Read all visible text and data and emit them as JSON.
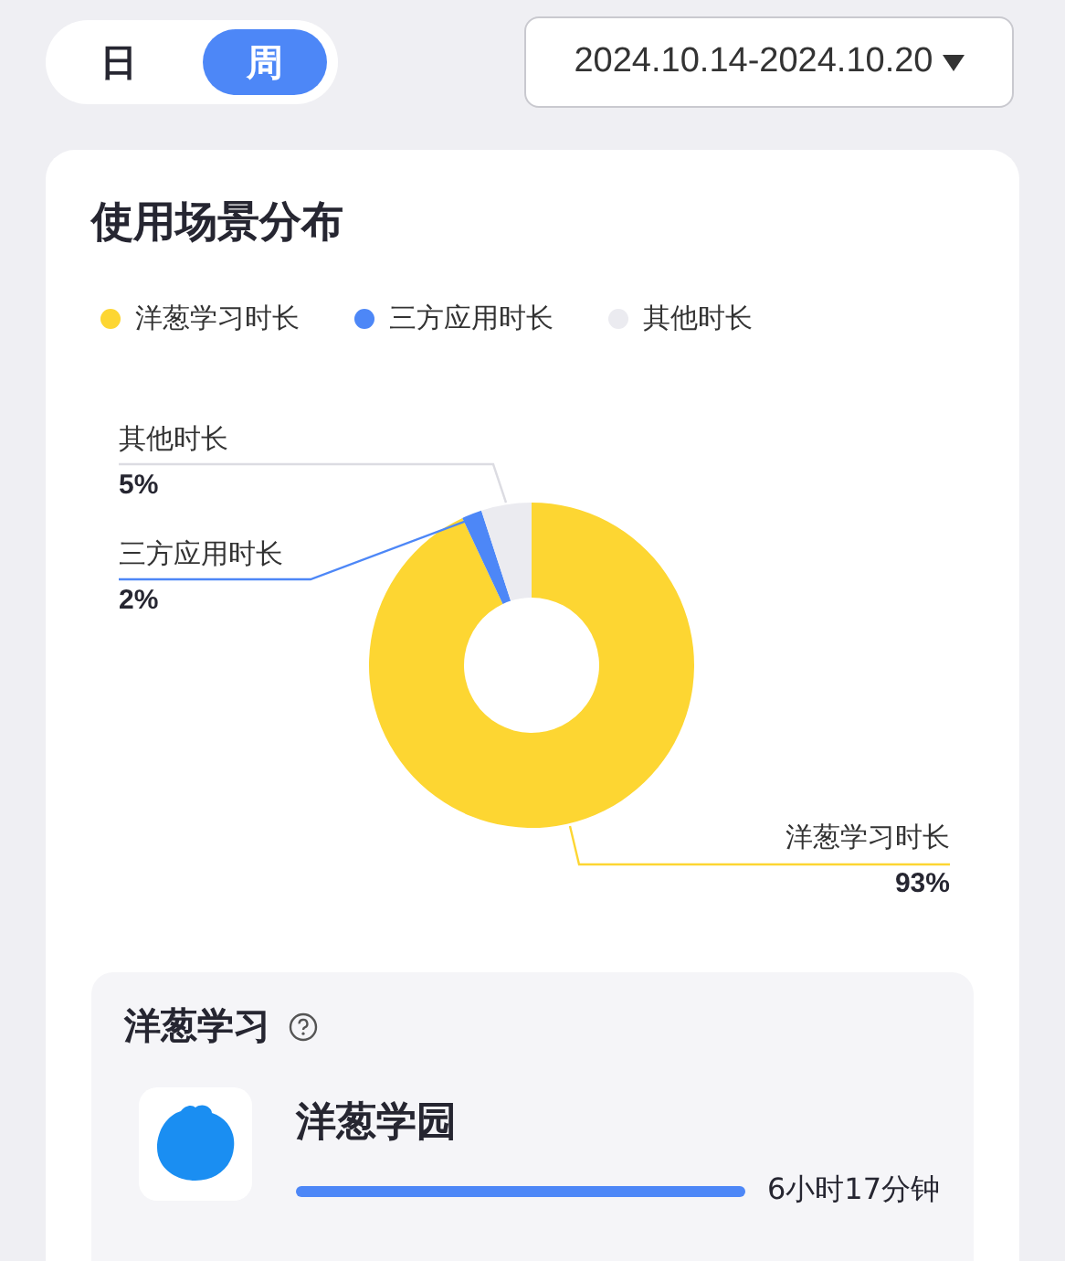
{
  "period_tabs": [
    {
      "label": "日",
      "selected": false
    },
    {
      "label": "周",
      "selected": true
    }
  ],
  "date_range": {
    "value": "2024.10.14-2024.10.20"
  },
  "usage_card": {
    "title": "使用场景分布",
    "legend": [
      {
        "label": "洋葱学习时长",
        "color": "#fdd632"
      },
      {
        "label": "三方应用时长",
        "color": "#4d87f7"
      },
      {
        "label": "其他时长",
        "color": "#ebebf0"
      }
    ],
    "chart_data": {
      "type": "donut",
      "categories": [
        "洋葱学习时长",
        "三方应用时长",
        "其他时长"
      ],
      "values": [
        93,
        2,
        5
      ],
      "data_labels": true,
      "value_labels": [
        "93%",
        "2%",
        "5%"
      ]
    }
  },
  "learning_section": {
    "title": "洋葱学习",
    "apps": [
      {
        "name": "洋葱学园",
        "duration": "6小时17分钟"
      }
    ]
  }
}
